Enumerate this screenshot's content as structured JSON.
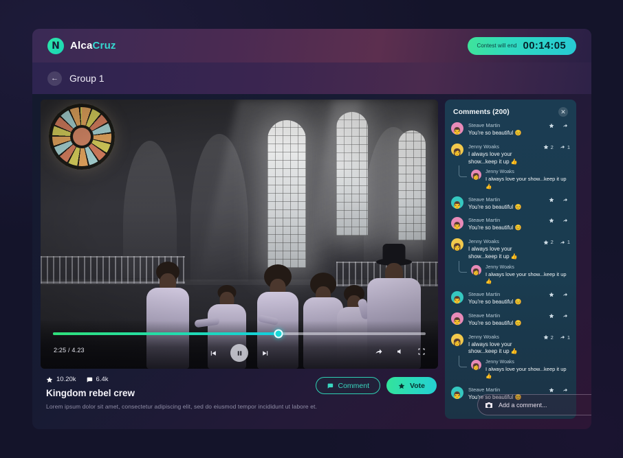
{
  "header": {
    "brand_first": "Alca",
    "brand_second": "Cruz",
    "logo_glyph": "N",
    "timer_label": "Contest will end",
    "timer_value": "00:14:05"
  },
  "subheader": {
    "back_icon": "arrow-left-icon",
    "group_title": "Group 1"
  },
  "video": {
    "time_current": "2:25",
    "time_total": "4.23",
    "time_label": "2:25 / 4.23",
    "progress_percent": 60.5,
    "prev_icon": "skip-previous-icon",
    "play_icon": "pause-icon",
    "next_icon": "skip-next-icon",
    "share_icon": "share-icon",
    "volume_icon": "volume-icon",
    "fullscreen_icon": "fullscreen-icon"
  },
  "info": {
    "star_count": "10.20k",
    "comment_count": "6.4k",
    "title": "Kingdom rebel crew",
    "description": "Lorem ipsum dolor sit amet, consectetur adipiscing elit, sed do eiusmod tempor incididunt ut labore et.",
    "comment_button": "Comment",
    "vote_button": "Vote"
  },
  "comments": {
    "title": "Comments (200)",
    "close_icon": "close-icon",
    "star_icon": "star-icon",
    "share_icon": "share-icon",
    "input_placeholder": "Add a comment...",
    "camera_icon": "camera-icon",
    "emoji_icon": "emoji-icon",
    "items": [
      {
        "name": "Steave Martin",
        "text": "You're so beautiful 😊",
        "avatar_bg": "#e88ab8",
        "avatar_glyph": "👨",
        "stars": "",
        "shares": "",
        "reply": null
      },
      {
        "name": "Jenny Woaks",
        "text": "I always love your show...keep it up 👍",
        "avatar_bg": "#f2c94c",
        "avatar_glyph": "👩",
        "stars": "2",
        "shares": "1",
        "reply": {
          "name": "Jenny Woaks",
          "text": "I always love your show...keep it up 👍",
          "avatar_bg": "#e88ab8",
          "avatar_glyph": "👩"
        }
      },
      {
        "name": "Steave Martin",
        "text": "You're so beautiful 😊",
        "avatar_bg": "#35c8c0",
        "avatar_glyph": "👨",
        "stars": "",
        "shares": "",
        "reply": null
      },
      {
        "name": "Steave Martin",
        "text": "You're so beautiful 😊",
        "avatar_bg": "#e88ab8",
        "avatar_glyph": "👨",
        "stars": "",
        "shares": "",
        "reply": null
      },
      {
        "name": "Jenny Woaks",
        "text": "I always love your show...keep it up 👍",
        "avatar_bg": "#f2c94c",
        "avatar_glyph": "👩",
        "stars": "2",
        "shares": "1",
        "reply": {
          "name": "Jenny Woaks",
          "text": "I always love your show...keep it up 👍",
          "avatar_bg": "#e88ab8",
          "avatar_glyph": "👩"
        }
      },
      {
        "name": "Steave Martin",
        "text": "You're so beautiful 😊",
        "avatar_bg": "#35c8c0",
        "avatar_glyph": "👨",
        "stars": "",
        "shares": "",
        "reply": null
      },
      {
        "name": "Steave Martin",
        "text": "You're so beautiful 😊",
        "avatar_bg": "#e88ab8",
        "avatar_glyph": "👨",
        "stars": "",
        "shares": "",
        "reply": null
      },
      {
        "name": "Jenny Woaks",
        "text": "I always love your show...keep it up 👍",
        "avatar_bg": "#f2c94c",
        "avatar_glyph": "👩",
        "stars": "2",
        "shares": "1",
        "reply": {
          "name": "Jenny Woaks",
          "text": "I always love your show...keep it up 👍",
          "avatar_bg": "#e88ab8",
          "avatar_glyph": "👩"
        }
      },
      {
        "name": "Steave Martin",
        "text": "You're so beautiful 😊",
        "avatar_bg": "#35c8c0",
        "avatar_glyph": "👨",
        "stars": "",
        "shares": "",
        "reply": null
      }
    ]
  },
  "colors": {
    "accent_green": "#2fe07a",
    "accent_teal": "#24cfd2",
    "panel_bg": "#1b3c52",
    "page_bg": "#14142a"
  }
}
